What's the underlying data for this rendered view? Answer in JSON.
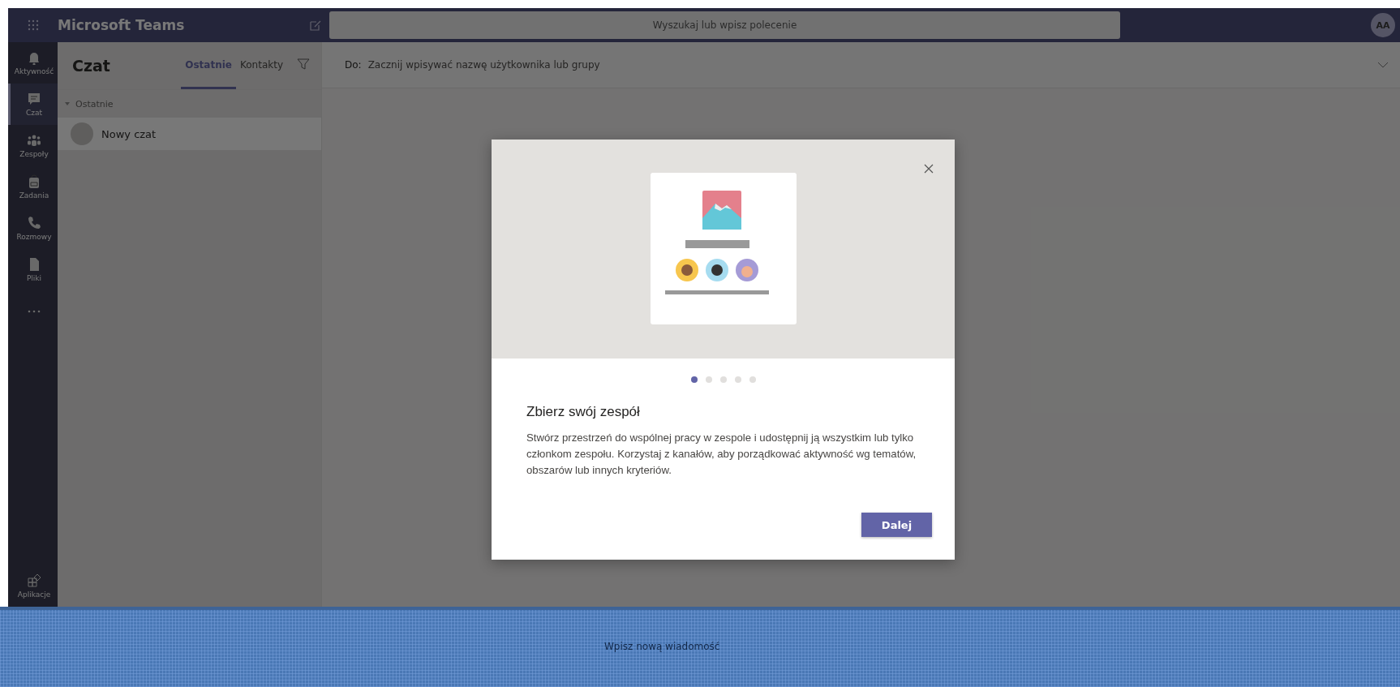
{
  "app": {
    "title": "Microsoft Teams"
  },
  "search": {
    "placeholder": "Wyszukaj lub wpisz polecenie"
  },
  "avatar": {
    "initials": "AA"
  },
  "rail": [
    {
      "label": "Aktywność",
      "kind": "bell",
      "selected": false
    },
    {
      "label": "Czat",
      "kind": "chat",
      "selected": true
    },
    {
      "label": "Zespoły",
      "kind": "teams",
      "selected": false
    },
    {
      "label": "Zadania",
      "kind": "bag",
      "selected": false
    },
    {
      "label": "Rozmowy",
      "kind": "phone",
      "selected": false
    },
    {
      "label": "Pliki",
      "kind": "file",
      "selected": false
    },
    {
      "kind": "more"
    }
  ],
  "rail_bottom": {
    "label": "Aplikacje"
  },
  "chat_list": {
    "title": "Czat",
    "tabs": [
      {
        "label": "Ostatnie",
        "selected": true
      },
      {
        "label": "Kontakty",
        "selected": false
      }
    ],
    "section": {
      "label": "Ostatnie",
      "expanded": true
    },
    "items": [
      {
        "name": "Nowy czat",
        "selected": true
      }
    ]
  },
  "to_field": {
    "label": "Do:",
    "placeholder": "Zacznij wpisywać nazwę użytkownika lub grupy"
  },
  "dialog": {
    "pages": [
      {
        "selected": true
      },
      {
        "selected": false
      },
      {
        "selected": false
      },
      {
        "selected": false
      },
      {
        "selected": false
      }
    ],
    "title": "Zbierz swój zespół",
    "body": "Stwórz przestrzeń do wspólnej pracy w zespole i udostępnij ją wszystkim lub tylko członkom zespołu. Korzystaj z kanałów, aby porządkować aktywność wg tematów, obszarów lub innych kryteriów.",
    "button": "Dalej"
  },
  "compose": {
    "placeholder": "Wpisz nową wiadomość"
  }
}
